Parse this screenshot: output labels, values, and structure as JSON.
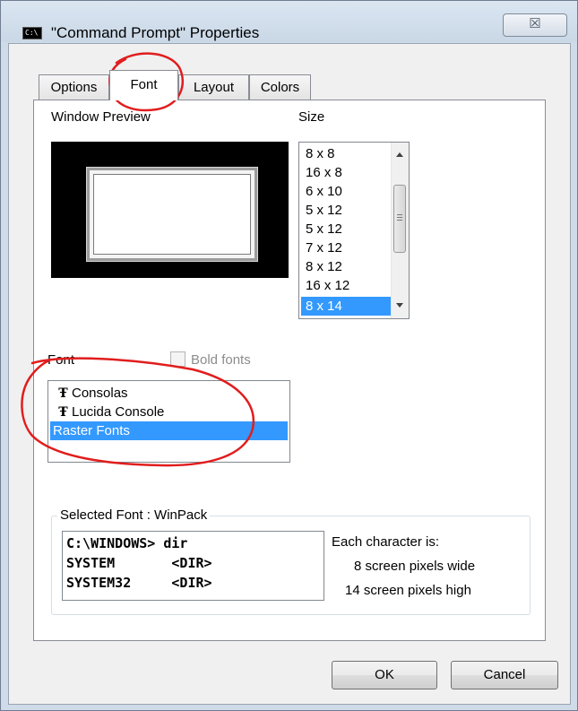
{
  "window": {
    "title": "\"Command Prompt\" Properties",
    "close_glyph": "☒"
  },
  "tabs": [
    {
      "label": "Options"
    },
    {
      "label": "Font"
    },
    {
      "label": "Layout"
    },
    {
      "label": "Colors"
    }
  ],
  "preview": {
    "label": "Window Preview"
  },
  "size": {
    "label": "Size",
    "items": [
      "8 x 8",
      "16 x 8",
      "6 x 10",
      "5 x 12",
      "5 x 12",
      "7 x 12",
      "8 x 12",
      "16 x 12",
      "8 x 14"
    ],
    "selected": "8 x 14"
  },
  "font": {
    "label": "Font",
    "bold_label": "Bold fonts",
    "bold_checked": false,
    "items": [
      "Consolas",
      "Lucida Console",
      "Raster Fonts"
    ],
    "truetype_glyph": "Ŧ",
    "selected": "Raster Fonts"
  },
  "selected_font": {
    "title": "Selected Font : WinPack",
    "sample_lines": [
      "C:\\WINDOWS> dir",
      "SYSTEM       <DIR>",
      "SYSTEM32     <DIR>"
    ],
    "info_title": "Each character is:",
    "width_text": "8 screen pixels wide",
    "height_text": "14 screen pixels high"
  },
  "buttons": {
    "ok": "OK",
    "cancel": "Cancel"
  },
  "colors": {
    "selection": "#3399ff",
    "annotation": "#e11d1d"
  }
}
